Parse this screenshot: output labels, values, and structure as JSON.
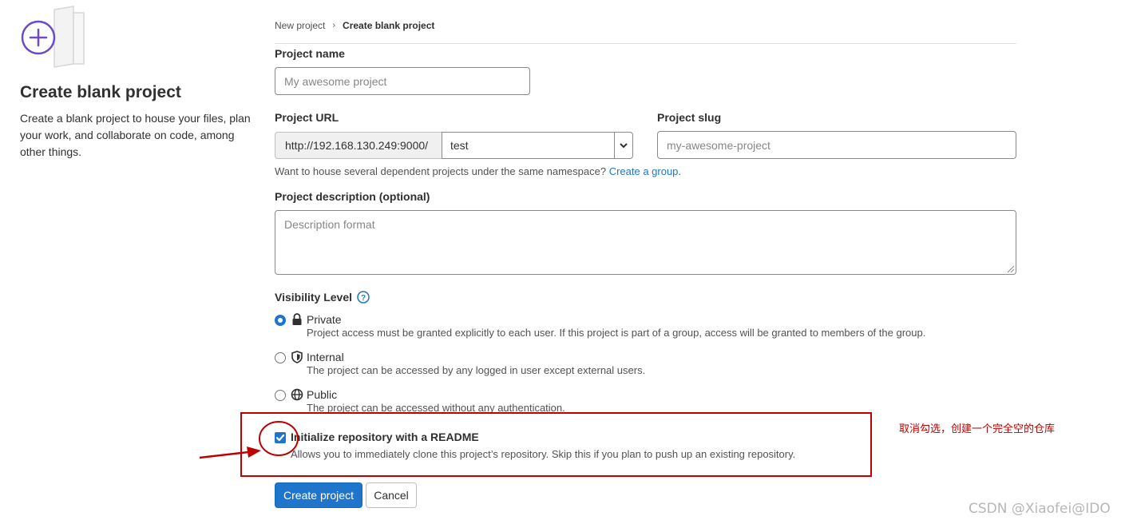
{
  "left": {
    "title": "Create blank project",
    "description": "Create a blank project to house your files, plan your work, and collaborate on code, among other things."
  },
  "breadcrumb": {
    "items": [
      "New project",
      "Create blank project"
    ],
    "separator_icon": "chevron-right-icon"
  },
  "form": {
    "project_name": {
      "label": "Project name",
      "placeholder": "My awesome project",
      "value": ""
    },
    "project_url": {
      "label": "Project URL",
      "prefix": "http://192.168.130.249:9000/",
      "namespace": "test"
    },
    "project_slug": {
      "label": "Project slug",
      "placeholder": "my-awesome-project",
      "value": ""
    },
    "namespace_help": {
      "text": "Want to house several dependent projects under the same namespace?",
      "link": "Create a group."
    },
    "description": {
      "label": "Project description (optional)",
      "placeholder": "Description format"
    },
    "visibility": {
      "label": "Visibility Level",
      "help_icon": "question-circle-icon",
      "options": [
        {
          "title": "Private",
          "icon": "lock-icon",
          "selected": true,
          "desc": "Project access must be granted explicitly to each user. If this project is part of a group, access will be granted to members of the group."
        },
        {
          "title": "Internal",
          "icon": "shield-icon",
          "selected": false,
          "desc": "The project can be accessed by any logged in user except external users."
        },
        {
          "title": "Public",
          "icon": "globe-icon",
          "selected": false,
          "desc": "The project can be accessed without any authentication."
        }
      ]
    },
    "readme": {
      "checked": true,
      "label": "Initialize repository with a README",
      "desc": "Allows you to immediately clone this project’s repository. Skip this if you plan to push up an existing repository."
    },
    "buttons": {
      "create": "Create project",
      "cancel": "Cancel"
    }
  },
  "annotation": {
    "text": "取消勾选，创建一个完全空的仓库",
    "color": "#c00000"
  },
  "watermark": "CSDN @Xiaofei@IDO",
  "colors": {
    "primary": "#1f75cb",
    "annotation": "#c00000"
  }
}
